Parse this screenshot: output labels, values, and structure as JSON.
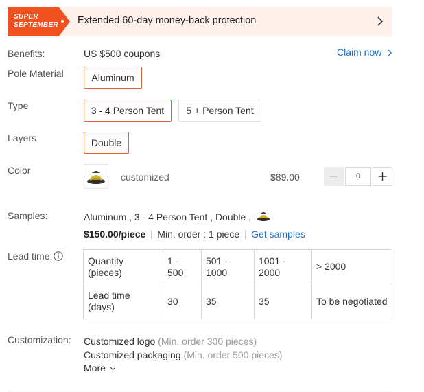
{
  "banner": {
    "badge_line1": "SUPER",
    "badge_line2": "SEPTEMBER",
    "text": "Extended 60-day money-back protection"
  },
  "benefits": {
    "label": "Benefits:",
    "value": "US $500 coupons",
    "claim": "Claim now"
  },
  "pole_material": {
    "label": "Pole Material",
    "options": [
      "Aluminum"
    ],
    "selected": "Aluminum"
  },
  "type": {
    "label": "Type",
    "options": [
      "3 - 4 Person Tent",
      "5 + Person Tent"
    ],
    "selected": "3 - 4 Person Tent"
  },
  "layers": {
    "label": "Layers",
    "options": [
      "Double"
    ],
    "selected": "Double"
  },
  "color": {
    "label": "Color",
    "name": "customized",
    "price": "$89.00",
    "quantity": "0"
  },
  "samples": {
    "label": "Samples:",
    "spec": "Aluminum , 3 - 4 Person Tent , Double ,",
    "price": "$150.00/piece",
    "min_order": "Min. order : 1 piece",
    "link": "Get samples"
  },
  "lead_time": {
    "label": "Lead time:",
    "rows": [
      [
        "Quantity (pieces)",
        "1 - 500",
        "501 - 1000",
        "1001 - 2000",
        "> 2000"
      ],
      [
        "Lead time (days)",
        "30",
        "35",
        "35",
        "To be negotiated"
      ]
    ]
  },
  "customization": {
    "label": "Customization:",
    "items": [
      {
        "name": "Customized logo",
        "note": "(Min. order 300 pieces)"
      },
      {
        "name": "Customized packaging",
        "note": "(Min. order 500 pieces)"
      }
    ],
    "more": "More"
  },
  "colors": {
    "accent": "#e5622e",
    "link": "#1d6fc4",
    "badge": "#f0501e",
    "banner_bg": "#fff1ec"
  },
  "icons": [
    "chevron-right-icon",
    "info-icon",
    "minus-icon",
    "plus-icon",
    "chevron-down-icon",
    "tent-thumbnail"
  ]
}
